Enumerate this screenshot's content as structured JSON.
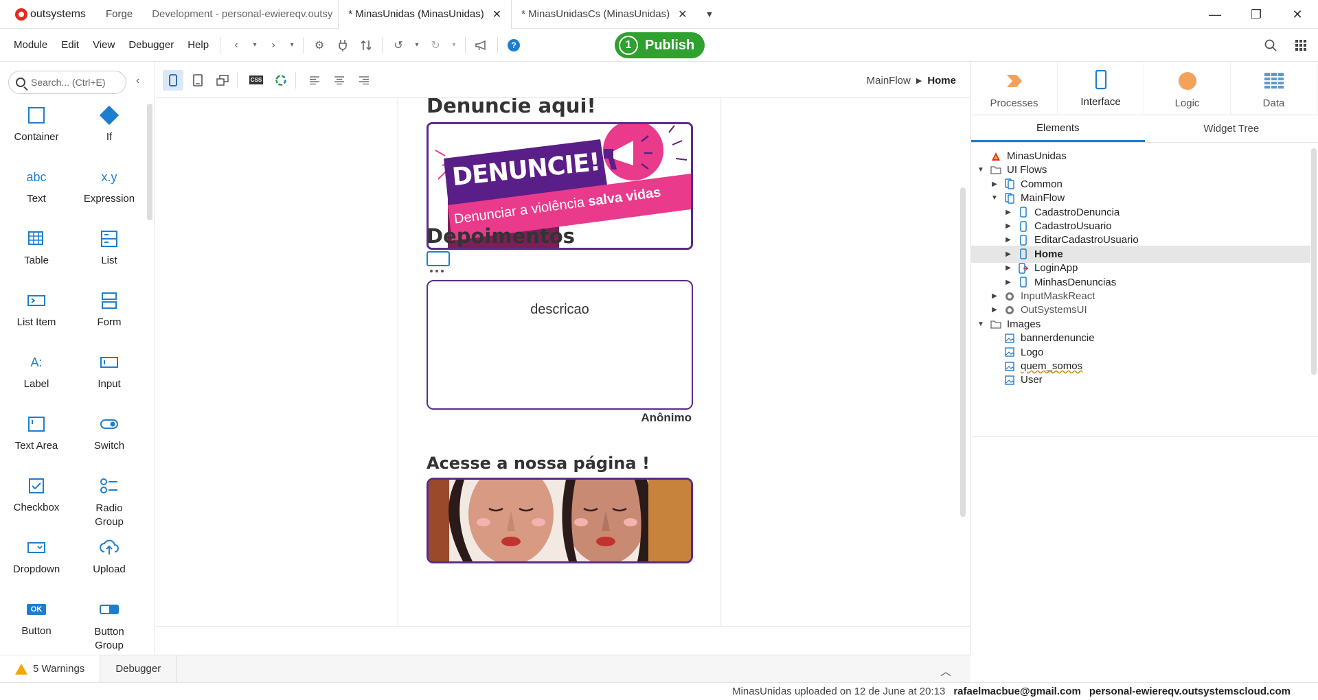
{
  "app": {
    "brand": "outsystems",
    "brand_color": "#e52b22"
  },
  "tabs": [
    {
      "label": "Forge"
    },
    {
      "label": "Development - personal-ewiereqv.outsy"
    },
    {
      "label": "* MinasUnidas (MinasUnidas)",
      "close": "✕"
    },
    {
      "label": "* MinasUnidasCs (MinasUnidas)",
      "close": "✕"
    }
  ],
  "tab_menu": "▼",
  "window_controls": {
    "minimize": "—",
    "restore": "❐",
    "close": "✕"
  },
  "menu": [
    "Module",
    "Edit",
    "View",
    "Debugger",
    "Help"
  ],
  "publish": {
    "count": "1",
    "label": "Publish",
    "color": "#2ea12f"
  },
  "toolbox": {
    "search_placeholder": "Search... (Ctrl+E)",
    "widgets": [
      {
        "label": "Container",
        "icon": "container-icon"
      },
      {
        "label": "If",
        "icon": "if-icon"
      },
      {
        "label": "Text",
        "icon": "text-icon",
        "glyph": "abc"
      },
      {
        "label": "Expression",
        "icon": "expression-icon",
        "glyph": "x.y"
      },
      {
        "label": "Table",
        "icon": "table-icon"
      },
      {
        "label": "List",
        "icon": "list-icon"
      },
      {
        "label": "List Item",
        "icon": "list-item-icon"
      },
      {
        "label": "Form",
        "icon": "form-icon"
      },
      {
        "label": "Label",
        "icon": "label-icon",
        "glyph": "A:"
      },
      {
        "label": "Input",
        "icon": "input-icon"
      },
      {
        "label": "Text Area",
        "icon": "text-area-icon"
      },
      {
        "label": "Switch",
        "icon": "switch-icon"
      },
      {
        "label": "Checkbox",
        "icon": "checkbox-icon"
      },
      {
        "label": "Radio Group",
        "icon": "radio-group-icon"
      },
      {
        "label": "Dropdown",
        "icon": "dropdown-icon"
      },
      {
        "label": "Upload",
        "icon": "upload-icon"
      },
      {
        "label": "Button",
        "icon": "button-icon",
        "glyph": "OK"
      },
      {
        "label": "Button Group",
        "icon": "button-group-icon"
      }
    ]
  },
  "canvas_toolbar": {
    "css_label": "CSS"
  },
  "breadcrumb": {
    "parent": "MainFlow",
    "current": "Home"
  },
  "screen": {
    "heading1": "Denuncie aqui!",
    "banner_title": "DENUNCIE!",
    "banner_sub_prefix": "Denunciar a violência",
    "banner_sub_bold": "salva vidas",
    "heading2": "Depoimentos",
    "testimonial_text": "descricao",
    "author": "Anônimo",
    "heading3": "Acesse a nossa página !"
  },
  "right_panel": {
    "tabs": [
      {
        "label": "Processes",
        "icon": "processes-icon"
      },
      {
        "label": "Interface",
        "icon": "interface-icon"
      },
      {
        "label": "Logic",
        "icon": "logic-icon"
      },
      {
        "label": "Data",
        "icon": "data-icon"
      }
    ],
    "subtabs": [
      "Elements",
      "Widget Tree"
    ],
    "tree": [
      {
        "label": "MinasUnidas",
        "level": 0,
        "toggle": "",
        "type": "module"
      },
      {
        "label": "UI Flows",
        "level": 0,
        "toggle": "▼",
        "type": "folder"
      },
      {
        "label": "Common",
        "level": 1,
        "toggle": "▶",
        "type": "flow"
      },
      {
        "label": "MainFlow",
        "level": 1,
        "toggle": "▼",
        "type": "flow"
      },
      {
        "label": "CadastroDenuncia",
        "level": 2,
        "toggle": "▶",
        "type": "screen"
      },
      {
        "label": "CadastroUsuario",
        "level": 2,
        "toggle": "▶",
        "type": "screen"
      },
      {
        "label": "EditarCadastroUsuario",
        "level": 2,
        "toggle": "▶",
        "type": "screen"
      },
      {
        "label": "Home",
        "level": 2,
        "toggle": "▶",
        "type": "screen",
        "selected": true
      },
      {
        "label": "LoginApp",
        "level": 2,
        "toggle": "▶",
        "type": "login"
      },
      {
        "label": "MinhasDenuncias",
        "level": 2,
        "toggle": "▶",
        "type": "screen"
      },
      {
        "label": "InputMaskReact",
        "level": 1,
        "toggle": "▶",
        "type": "dependency"
      },
      {
        "label": "OutSystemsUI",
        "level": 1,
        "toggle": "▶",
        "type": "dependency"
      },
      {
        "label": "Images",
        "level": 0,
        "toggle": "▼",
        "type": "folder"
      },
      {
        "label": "bannerdenuncie",
        "level": 1,
        "toggle": "",
        "type": "image"
      },
      {
        "label": "Logo",
        "level": 1,
        "toggle": "",
        "type": "image"
      },
      {
        "label": "quem_somos",
        "level": 1,
        "toggle": "",
        "type": "image"
      },
      {
        "label": "User",
        "level": 1,
        "toggle": "",
        "type": "image"
      }
    ]
  },
  "bottom": {
    "warnings": "5 Warnings",
    "debugger": "Debugger"
  },
  "status": {
    "message": "MinasUnidas uploaded on 12 de June at 20:13",
    "user": "rafaelmacbue@gmail.com",
    "server": "personal-ewiereqv.outsystemscloud.com"
  }
}
